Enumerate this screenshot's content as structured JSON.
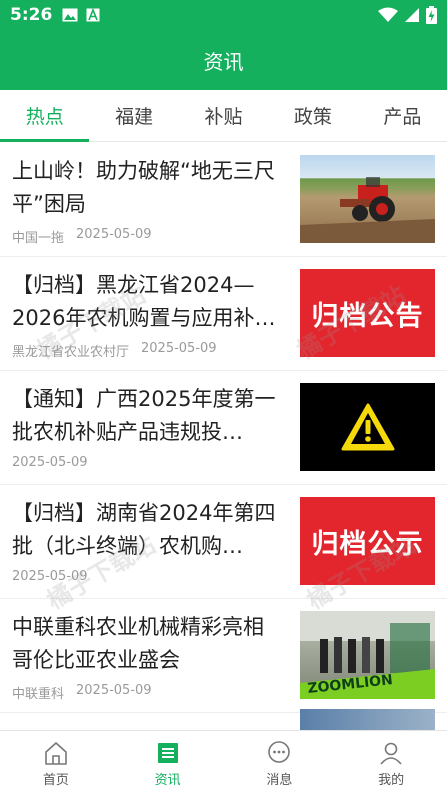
{
  "status_bar": {
    "time": "5:26",
    "left_icons": [
      "image-icon",
      "a-badge-icon"
    ],
    "right_icons": [
      "wifi-icon",
      "signal-icon",
      "battery-charging-icon"
    ]
  },
  "header": {
    "title": "资讯",
    "background": "#14b05e"
  },
  "tabs": [
    {
      "label": "热点",
      "active": true
    },
    {
      "label": "福建",
      "active": false
    },
    {
      "label": "补贴",
      "active": false
    },
    {
      "label": "政策",
      "active": false
    },
    {
      "label": "产品",
      "active": false
    }
  ],
  "news": [
    {
      "title": "上山岭！助力破解“地无三尺平”困局",
      "source": "中国一拖",
      "date": "2025-05-09",
      "thumb_text": "",
      "thumb_kind": "tractor-photo"
    },
    {
      "title": "【归档】黑龙江省2024—2026年农机购置与应用补…",
      "source": "黑龙江省农业农村厅",
      "date": "2025-05-09",
      "thumb_text": "归档公告",
      "thumb_kind": "red-banner"
    },
    {
      "title": "【通知】广西2025年度第一批农机补贴产品违规投…",
      "source": "",
      "date": "2025-05-09",
      "thumb_text": "",
      "thumb_kind": "warning-sign"
    },
    {
      "title": "【归档】湖南省2024年第四批（北斗终端）农机购…",
      "source": "",
      "date": "2025-05-09",
      "thumb_text": "归档公示",
      "thumb_kind": "red-banner"
    },
    {
      "title": "中联重科农业机械精彩亮相哥伦比亚农业盛会",
      "source": "中联重科",
      "date": "2025-05-09",
      "thumb_text": "ZOOMLION",
      "thumb_kind": "event-photo"
    }
  ],
  "watermark": "橘子下载站",
  "bottom_nav": [
    {
      "label": "首页",
      "icon": "home-icon",
      "active": false
    },
    {
      "label": "资讯",
      "icon": "news-icon",
      "active": true
    },
    {
      "label": "消息",
      "icon": "message-icon",
      "active": false
    },
    {
      "label": "我的",
      "icon": "profile-icon",
      "active": false
    }
  ],
  "colors": {
    "brand_green": "#14b05e",
    "archive_red": "#e3262d",
    "warning_yellow": "#f5d90a"
  }
}
